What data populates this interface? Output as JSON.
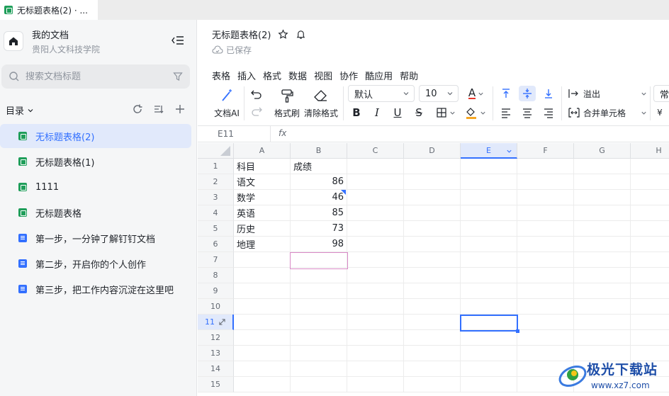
{
  "tab": {
    "title": "无标题表格(2) · ..."
  },
  "sidebar": {
    "workspace_title": "我的文档",
    "workspace_sub": "贵阳人文科技学院",
    "search_placeholder": "搜索文档标题",
    "directory_label": "目录",
    "items": [
      {
        "label": "无标题表格(2)",
        "type": "sheet",
        "active": true
      },
      {
        "label": "无标题表格(1)",
        "type": "sheet",
        "active": false
      },
      {
        "label": "1111",
        "type": "sheet",
        "active": false
      },
      {
        "label": "无标题表格",
        "type": "sheet",
        "active": false
      },
      {
        "label": "第一步，一分钟了解钉钉文档",
        "type": "doc",
        "active": false
      },
      {
        "label": "第二步，开启你的个人创作",
        "type": "doc",
        "active": false
      },
      {
        "label": "第三步，把工作内容沉淀在这里吧",
        "type": "doc",
        "active": false
      }
    ]
  },
  "header": {
    "title": "无标题表格(2)",
    "saved": "已保存"
  },
  "menu": [
    "表格",
    "插入",
    "格式",
    "数据",
    "视图",
    "协作",
    "酷应用",
    "帮助"
  ],
  "toolbar": {
    "ai_label": "文档AI",
    "format_painter": "格式刷",
    "clear_format": "清除格式",
    "font": "默认",
    "font_size": "10",
    "overflow": "溢出",
    "merge": "合并单元格",
    "number_format": "常",
    "currency": "¥",
    "text_color": "A",
    "bold": "B",
    "italic": "I",
    "underline": "U",
    "strike": "S"
  },
  "formula_bar": {
    "name_box": "E11",
    "fx": "fx"
  },
  "grid": {
    "columns": [
      "A",
      "B",
      "C",
      "D",
      "E",
      "F",
      "G",
      "H"
    ],
    "rows": [
      "1",
      "2",
      "3",
      "4",
      "5",
      "6",
      "7",
      "8",
      "9",
      "10",
      "11",
      "12",
      "13",
      "14",
      "15"
    ],
    "data": [
      [
        "科目",
        "成绩"
      ],
      [
        "语文",
        "86"
      ],
      [
        "数学",
        "46"
      ],
      [
        "英语",
        "85"
      ],
      [
        "历史",
        "73"
      ],
      [
        "地理",
        "98"
      ]
    ]
  },
  "watermark": {
    "title": "极光下载站",
    "url": "www.xz7.com"
  },
  "colors": {
    "accent": "#3370ff",
    "sheet_icon": "#1f9e5a",
    "doc_icon": "#3370ff",
    "highlight": "#d98ac7"
  }
}
